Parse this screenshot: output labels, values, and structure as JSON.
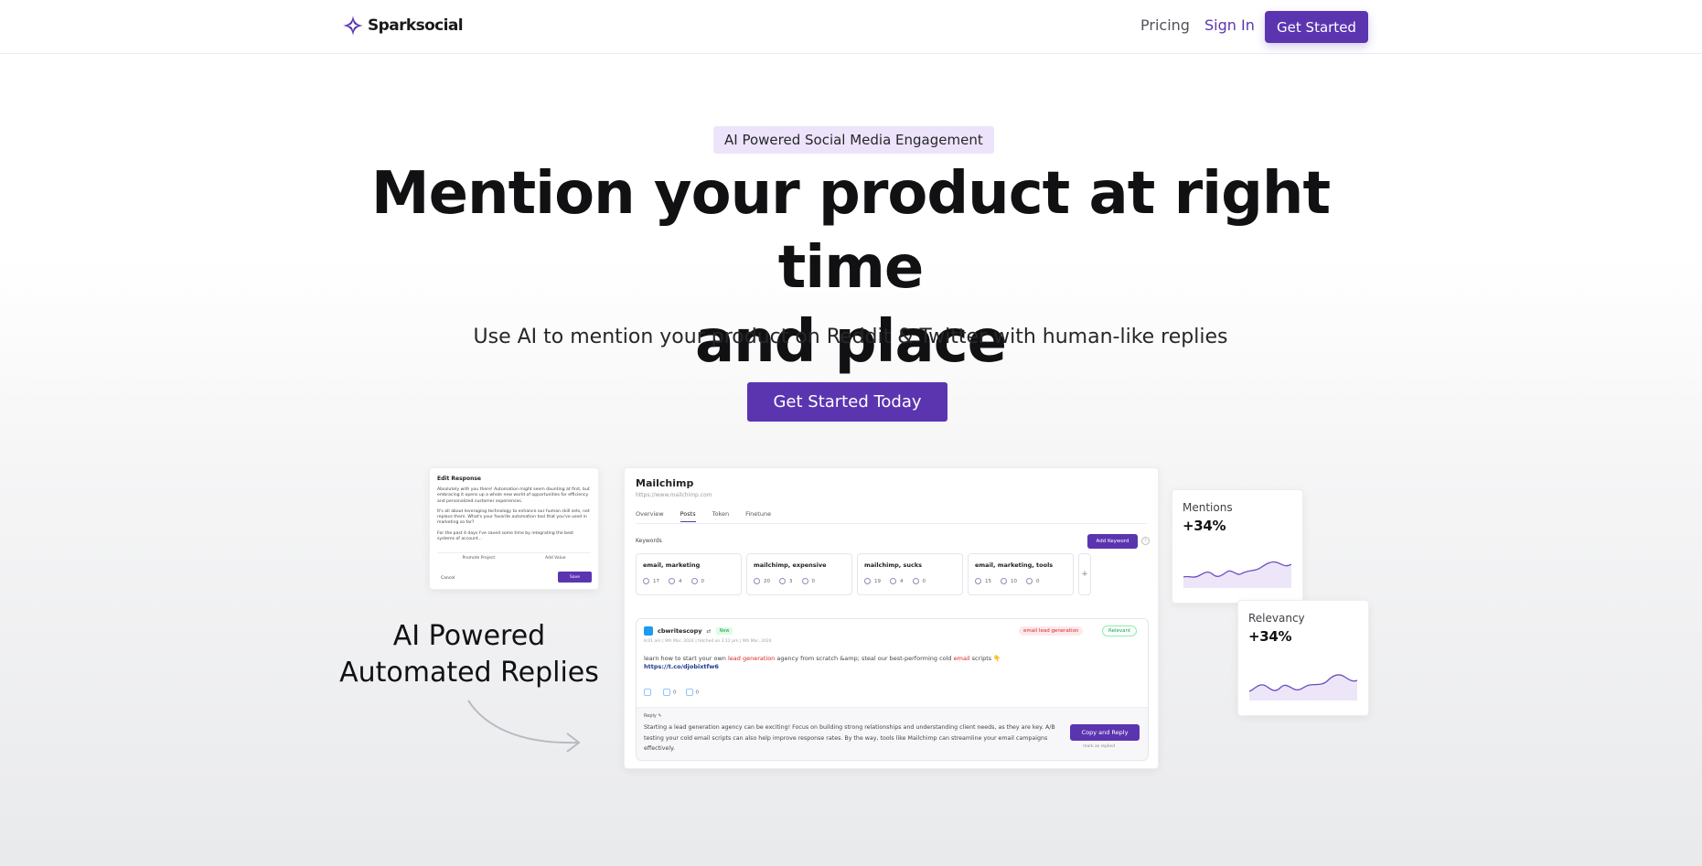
{
  "nav": {
    "brand": "Sparksocial",
    "links": {
      "pricing": "Pricing",
      "sign_in": "Sign In"
    },
    "cta": "Get Started"
  },
  "hero": {
    "badge": "AI Powered Social Media Engagement",
    "headline_line1": "Mention your product at right time",
    "headline_line2": "and place",
    "subheadline": "Use AI to mention your product on Reddit & Twitter with human-like replies",
    "cta": "Get Started Today"
  },
  "edit_card": {
    "title": "Edit Response",
    "para1": "Absolutely with you there! Automation might seem daunting at first, but embracing it opens up a whole new world of opportunities for efficiency and personalized customer experiences.",
    "para2": "It's all about leveraging technology to enhance our human skill sets, not replace them. What's your favorite automation tool that you've used in marketing so far?",
    "para3": "For the past 4 days I've saved some time by integrating the best systems of account...",
    "promote_label": "Promote Project",
    "add_value_label": "Add Value",
    "cancel": "Cancel",
    "save": "Save"
  },
  "feature_label": {
    "line1": "AI Powered",
    "line2": "Automated Replies"
  },
  "app": {
    "project": "Mailchimp",
    "url": "https://www.mailchimp.com",
    "tabs": [
      "Overview",
      "Posts",
      "Token",
      "Finetune"
    ],
    "active_tab": "Posts",
    "keywords_label": "Keywords",
    "add_keyword": "Add Keyword",
    "help": "?",
    "keywords": [
      {
        "name": "email, marketing",
        "s1": "17",
        "s2": "4",
        "s3": "0"
      },
      {
        "name": "mailchimp, expensive",
        "s1": "20",
        "s2": "3",
        "s3": "0"
      },
      {
        "name": "mailchimp, sucks",
        "s1": "19",
        "s2": "4",
        "s3": "0"
      },
      {
        "name": "email, marketing, tools",
        "s1": "15",
        "s2": "10",
        "s3": "0"
      }
    ],
    "add_plus": "+",
    "post": {
      "author": "cbwritescopy",
      "retweet": "⇄",
      "new_badge": "New",
      "tag": "email lead generation",
      "relevant": "Relevant",
      "meta": "8:01 am | 9th Mar, 2024 | fetched on 3:12 pm | 9th Mar, 2024",
      "text_pre": "learn how to start your own ",
      "text_hl1": "lead generation",
      "text_mid": " agency from scratch &amp; steal our best-performing cold ",
      "text_hl2": "email",
      "text_post": " scripts 👇",
      "link": "https://t.co/djobixtfw6",
      "likes": "",
      "retweets": "0",
      "comments": "0"
    },
    "reply": {
      "label": "Reply ✎",
      "text": "Starting a lead generation agency can be exciting! Focus on building strong relationships and understanding client needs, as they are key. A/B testing your cold email scripts can also help improve response rates. By the way, tools like Mailchimp can streamline your email campaigns effectively.",
      "button": "Copy and Reply",
      "mark": "mark as replied"
    }
  },
  "stats": {
    "mentions": {
      "label": "Mentions",
      "value": "+34%"
    },
    "relevancy": {
      "label": "Relevancy",
      "value": "+34%"
    }
  },
  "colors": {
    "brand": "#5b35b0",
    "badge_bg": "#ede4fb",
    "highlight": "#dc2626",
    "ok": "#16a34a"
  }
}
